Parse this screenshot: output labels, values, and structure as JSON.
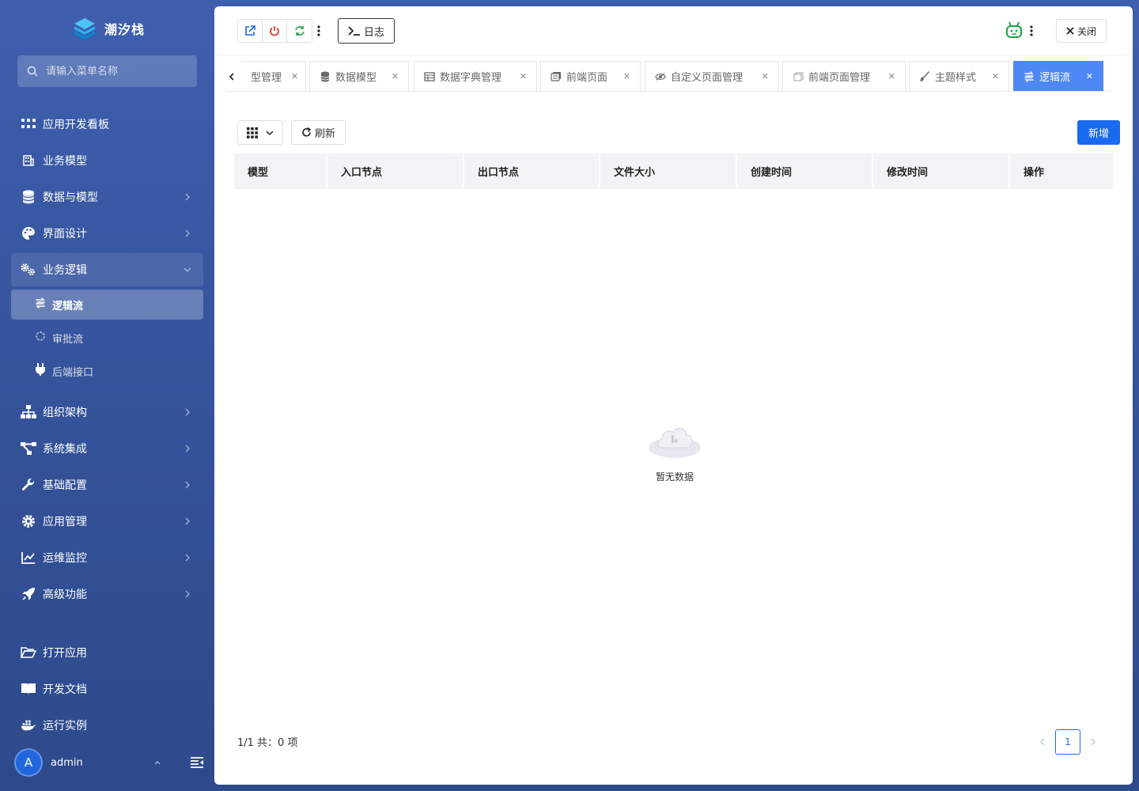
{
  "app": {
    "logo_text": "潮汐栈"
  },
  "search": {
    "placeholder": "请输入菜单名称"
  },
  "menu": {
    "items": [
      {
        "label": "应用开发看板",
        "icon": "grid-dots-icon"
      },
      {
        "label": "业务模型",
        "icon": "building-icon"
      },
      {
        "label": "数据与模型",
        "icon": "database-icon"
      },
      {
        "label": "界面设计",
        "icon": "palette-icon"
      },
      {
        "label": "业务逻辑",
        "icon": "gears-icon"
      },
      {
        "label": "组织架构",
        "icon": "org-chart-icon"
      },
      {
        "label": "系统集成",
        "icon": "integration-icon"
      },
      {
        "label": "基础配置",
        "icon": "wrench-icon"
      },
      {
        "label": "应用管理",
        "icon": "gear-icon"
      },
      {
        "label": "运维监控",
        "icon": "line-chart-icon"
      },
      {
        "label": "高级功能",
        "icon": "rocket-icon"
      }
    ],
    "sub_items": [
      {
        "label": "逻辑流",
        "icon": "flow-icon"
      },
      {
        "label": "审批流",
        "icon": "approval-icon"
      },
      {
        "label": "后端接口",
        "icon": "plug-icon"
      }
    ],
    "bottom": [
      {
        "label": "打开应用",
        "icon": "folder-open-icon"
      },
      {
        "label": "开发文档",
        "icon": "book-icon"
      },
      {
        "label": "运行实例",
        "icon": "docker-icon"
      }
    ]
  },
  "user": {
    "avatar_letter": "A",
    "name": "admin"
  },
  "topbar": {
    "log_label": "日志",
    "close_label": "关闭"
  },
  "tabs": [
    {
      "label": "型管理",
      "icon": "none"
    },
    {
      "label": "数据模型",
      "icon": "database-icon"
    },
    {
      "label": "数据字典管理",
      "icon": "table-icon"
    },
    {
      "label": "前端页面",
      "icon": "pages-icon"
    },
    {
      "label": "自定义页面管理",
      "icon": "eye-icon"
    },
    {
      "label": "前端页面管理",
      "icon": "window-icon"
    },
    {
      "label": "主题样式",
      "icon": "brush-icon"
    },
    {
      "label": "逻辑流",
      "icon": "flow-icon",
      "active": true
    }
  ],
  "toolbar": {
    "refresh_label": "刷新",
    "add_label": "新增"
  },
  "table": {
    "columns": [
      "模型",
      "入口节点",
      "出口节点",
      "文件大小",
      "创建时间",
      "修改时间",
      "操作"
    ],
    "empty_text": "暂无数据"
  },
  "footer": {
    "count_text": "1/1 共：0 项",
    "current_page": "1"
  },
  "colors": {
    "primary": "#1a6af0",
    "active_tab": "#4e88f6",
    "sidebar": "#3a5aa6"
  }
}
